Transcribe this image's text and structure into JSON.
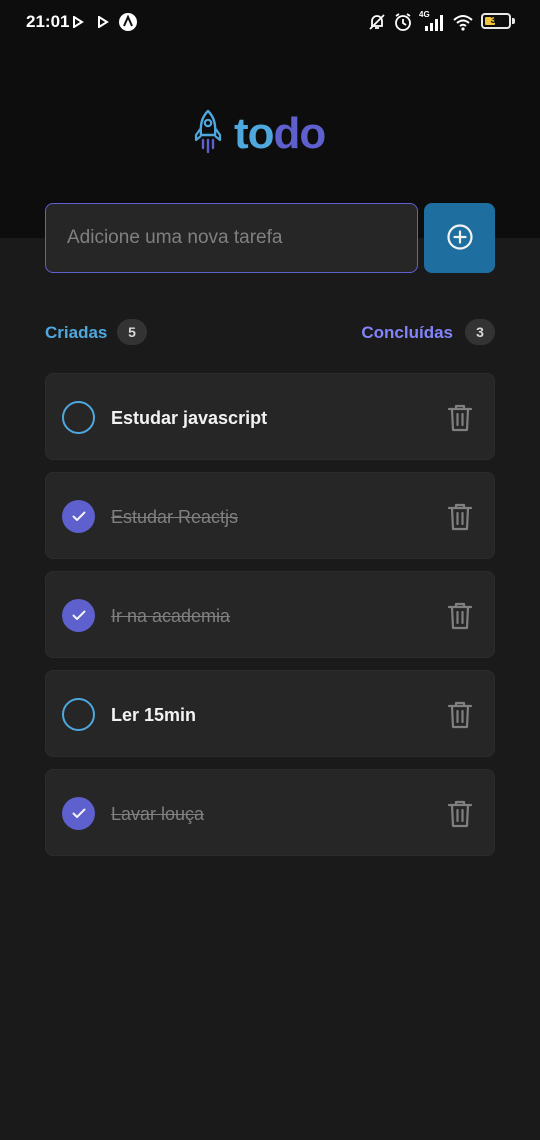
{
  "status_bar": {
    "time": "21:01",
    "left_icons": [
      "play-notification-icon",
      "play-notification-icon",
      "app-notification-icon"
    ],
    "right_icons": [
      "notifications-off-icon",
      "alarm-icon",
      "signal-icon",
      "wifi-icon",
      "battery-icon"
    ],
    "network": "4G",
    "battery": "32"
  },
  "header": {
    "logo_icon": "rocket-icon",
    "logo_part1": "to",
    "logo_part2": "do"
  },
  "new_task": {
    "placeholder": "Adicione uma nova tarefa",
    "value": "",
    "add_icon": "plus-circle-icon"
  },
  "counters": {
    "created_label": "Criadas",
    "created_count": "5",
    "done_label": "Concluídas",
    "done_count": "3"
  },
  "tasks": [
    {
      "text": "Estudar javascript",
      "done": false
    },
    {
      "text": "Estudar Reactjs",
      "done": true
    },
    {
      "text": "Ir na academia",
      "done": true
    },
    {
      "text": "Ler 15min",
      "done": false
    },
    {
      "text": "Lavar louça",
      "done": true
    }
  ],
  "colors": {
    "blue": "#4ea8de",
    "purple": "#5e60ce",
    "button": "#1e6f9f",
    "background": "#1a1a1a",
    "card": "#262626"
  }
}
